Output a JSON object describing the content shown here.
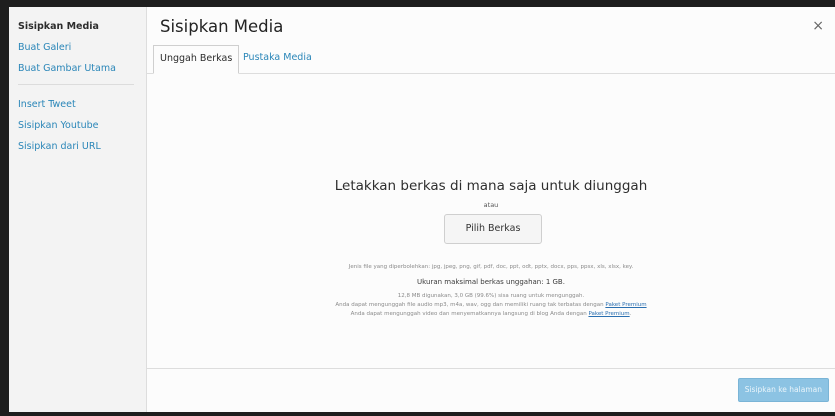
{
  "sidebar": {
    "items": [
      {
        "label": "Sisipkan Media"
      },
      {
        "label": "Buat Galeri"
      },
      {
        "label": "Buat Gambar Utama"
      },
      {
        "label": "Insert Tweet"
      },
      {
        "label": "Sisipkan Youtube"
      },
      {
        "label": "Sisipkan dari URL"
      }
    ]
  },
  "header": {
    "title": "Sisipkan Media",
    "close_glyph": "×"
  },
  "tabs": [
    {
      "label": "Unggah Berkas",
      "active": true
    },
    {
      "label": "Pustaka Media",
      "active": false
    }
  ],
  "upload": {
    "heading": "Letakkan berkas di mana saja untuk diunggah",
    "or_text": "atau",
    "select_button": "Pilih Berkas",
    "allowed_types": "Jenis file yang diperbolehkan: jpg, jpeg, png, gif, pdf, doc, ppt, odt, pptx, docx, pps, ppsx, xls, xlsx, key.",
    "max_size": "Ukuran maksimal berkas unggahan: 1 GB.",
    "storage_used": "12,8 MB digunakan, 3,0 GB (99.6%) sisa ruang untuk mengunggah.",
    "audio_note": "Anda dapat mengunggah file audio mp3, m4a, wav, ogg dan memiliki ruang tak terbatas dengan",
    "audio_link": "Paket Premium",
    "video_note": "Anda dapat mengunggah video dan menyematkannya langsung di blog Anda dengan",
    "video_link": "Paket Premium",
    "video_suffix": "."
  },
  "footer": {
    "insert_button": "Sisipkan ke halaman"
  },
  "colors": {
    "link": "#2a86b8",
    "primary_button": "#8cc3e3"
  }
}
